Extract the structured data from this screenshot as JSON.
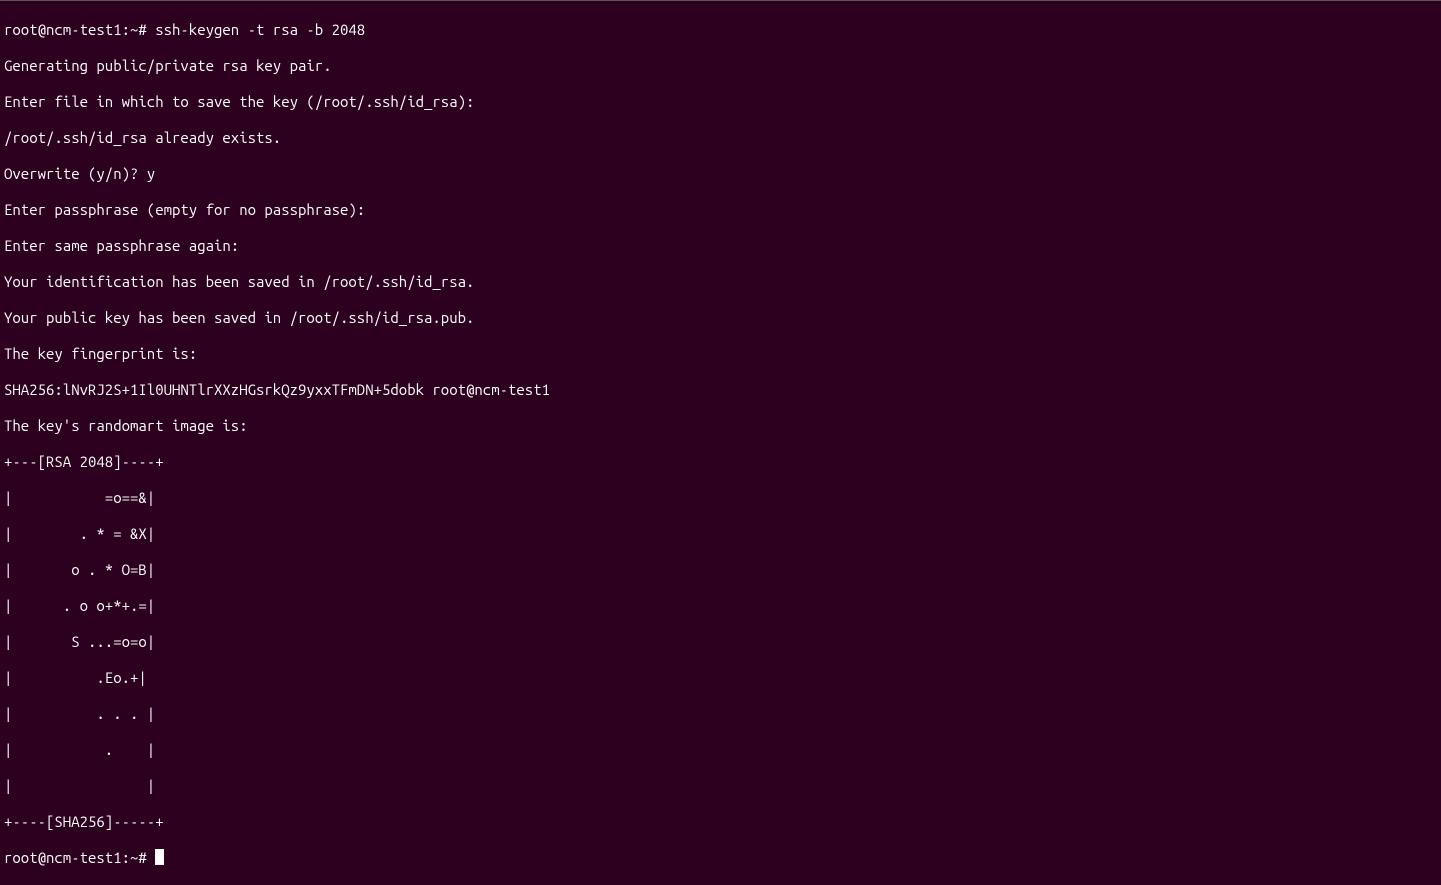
{
  "terminal": {
    "lines": [
      "root@ncm-test1:~# ssh-keygen -t rsa -b 2048",
      "Generating public/private rsa key pair.",
      "Enter file in which to save the key (/root/.ssh/id_rsa):",
      "/root/.ssh/id_rsa already exists.",
      "Overwrite (y/n)? y",
      "Enter passphrase (empty for no passphrase):",
      "Enter same passphrase again:",
      "Your identification has been saved in /root/.ssh/id_rsa.",
      "Your public key has been saved in /root/.ssh/id_rsa.pub.",
      "The key fingerprint is:",
      "SHA256:lNvRJ2S+1Il0UHNTlrXXzHGsrkQz9yxxTFmDN+5dobk root@ncm-test1",
      "The key's randomart image is:",
      "+---[RSA 2048]----+",
      "|           =o==&|",
      "|        . * = &X|",
      "|       o . * O=B|",
      "|      . o o+*+.=|",
      "|       S ...=o=o|",
      "|          .Eo.+|",
      "|          . . . |",
      "|           .    |",
      "|                |",
      "+----[SHA256]-----+"
    ],
    "prompt": "root@ncm-test1:~# "
  }
}
